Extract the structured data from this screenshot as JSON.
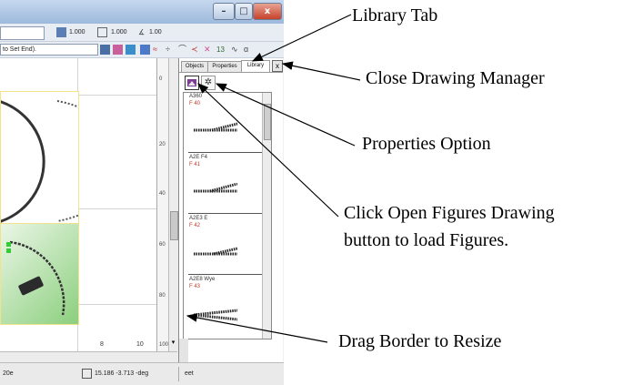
{
  "window": {
    "minimize": "–",
    "maximize": "□",
    "close": "x"
  },
  "toolbar": {
    "field1": "1.000",
    "field2": "1.000",
    "field3": "1.00",
    "snap_label": "to Set End)."
  },
  "drawing": {
    "close": "x",
    "ruler_ticks": [
      "0",
      "20",
      "40",
      "60",
      "80",
      "100"
    ],
    "bottom_ticks": [
      "8",
      "10"
    ]
  },
  "drawing_manager": {
    "close": "x",
    "tabs": [
      "Objects",
      "Properties",
      "Library"
    ],
    "figures": [
      {
        "name": "A360",
        "code": "F 40"
      },
      {
        "name": "A2E F4",
        "code": "F 41"
      },
      {
        "name": "A2E3 E",
        "code": "F 42"
      },
      {
        "name": "A2E8 Wye",
        "code": "F 43"
      }
    ]
  },
  "statusbar": {
    "left": "20e",
    "coords": "15.186 -3.713 -deg",
    "right": "eet"
  },
  "annotations": {
    "library_tab": "Library Tab",
    "close_manager": "Close Drawing Manager",
    "properties": "Properties Option",
    "open_figures_line1": "Click Open Figures Drawing",
    "open_figures_line2": "button to load Figures.",
    "resize": "Drag Border to Resize"
  }
}
